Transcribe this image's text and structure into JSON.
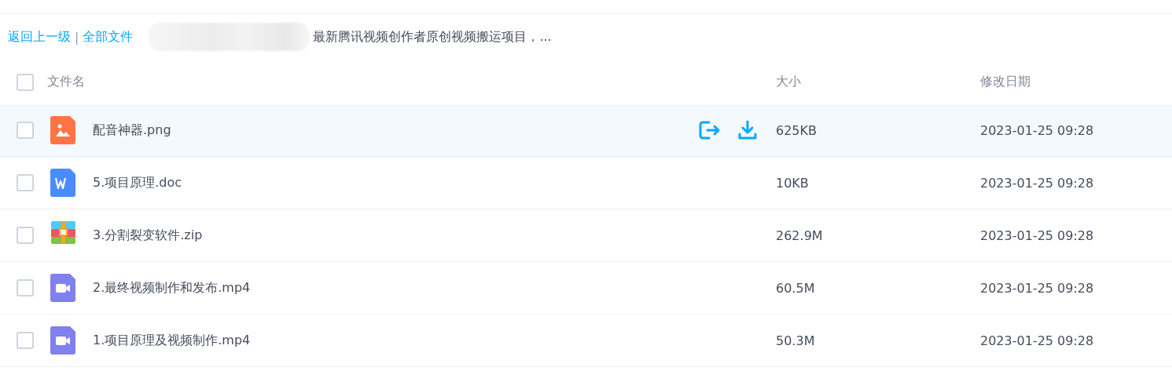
{
  "breadcrumb": {
    "back": "返回上一级",
    "separator": "|",
    "root": "全部文件",
    "current": "最新腾讯视频创作者原创视频搬运项目，..."
  },
  "table": {
    "columns": [
      "文件名",
      "大小",
      "修改日期"
    ],
    "select_all_checked": false,
    "rows": [
      {
        "kind": "image",
        "name": "配音神器.png",
        "size": "625KB",
        "date": "2023-01-25 09:28",
        "checked": false,
        "hovered": true
      },
      {
        "kind": "word",
        "name": "5.项目原理.doc",
        "size": "10KB",
        "date": "2023-01-25 09:28",
        "checked": false,
        "hovered": false
      },
      {
        "kind": "zip",
        "name": "3.分割裂变软件.zip",
        "size": "262.9M",
        "date": "2023-01-25 09:28",
        "checked": false,
        "hovered": false
      },
      {
        "kind": "video",
        "name": "2.最终视频制作和发布.mp4",
        "size": "60.5M",
        "date": "2023-01-25 09:28",
        "checked": false,
        "hovered": false
      },
      {
        "kind": "video",
        "name": "1.项目原理及视频制作.mp4",
        "size": "50.3M",
        "date": "2023-01-25 09:28",
        "checked": false,
        "hovered": false
      }
    ]
  }
}
